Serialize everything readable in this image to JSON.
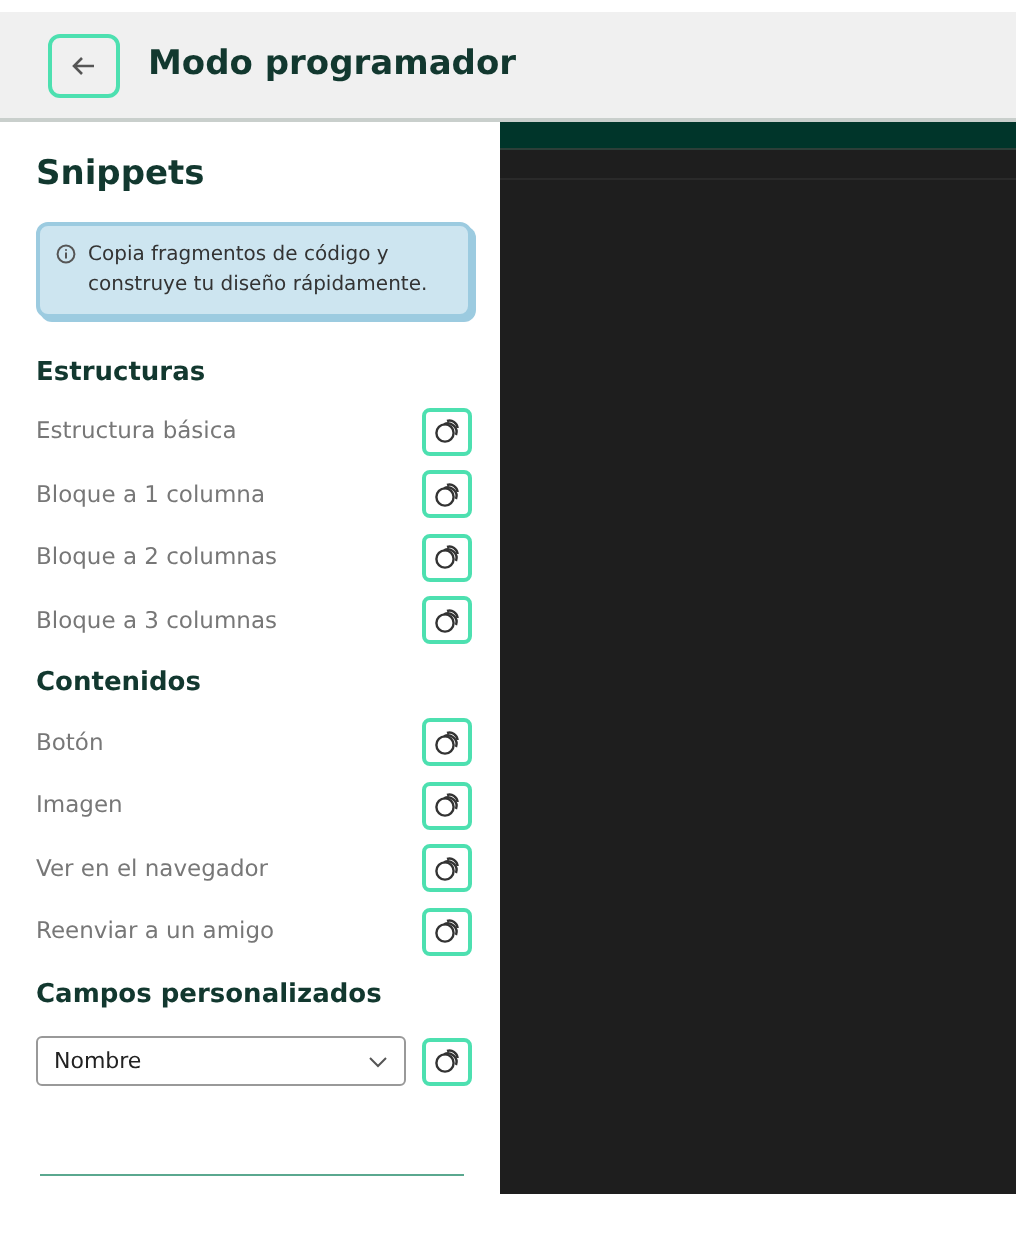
{
  "header": {
    "title": "Modo programador"
  },
  "sidebar": {
    "title": "Snippets",
    "info": "Copia fragmentos de código y construye tu diseño rápidamente.",
    "sections": [
      {
        "title": "Estructuras",
        "items": [
          "Estructura básica",
          "Bloque a 1 columna",
          "Bloque a 2 columnas",
          "Bloque a 3 columnas"
        ]
      },
      {
        "title": "Contenidos",
        "items": [
          "Botón",
          "Imagen",
          "Ver en el navegador",
          "Reenviar a un amigo"
        ]
      }
    ],
    "custom_fields": {
      "title": "Campos personalizados",
      "value": "Nombre"
    }
  }
}
